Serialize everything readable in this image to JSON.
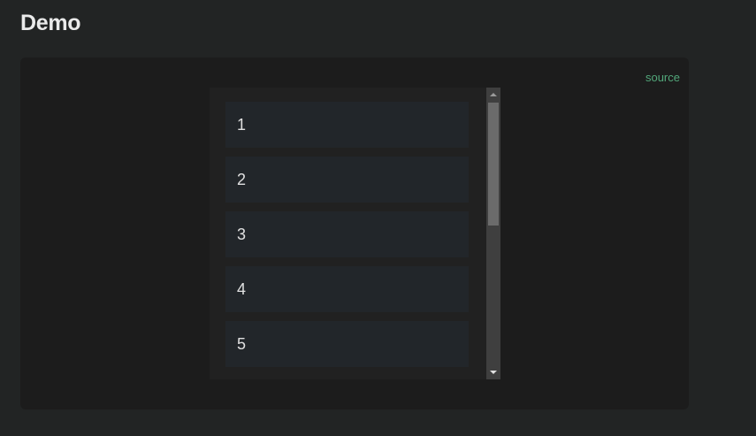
{
  "page": {
    "title": "Demo"
  },
  "demo": {
    "source_link": "source",
    "items": [
      "1",
      "2",
      "3",
      "4",
      "5"
    ]
  },
  "scrollbar": {
    "position_fraction": 0.0,
    "visible_fraction": 0.44
  },
  "colors": {
    "background": "#222424",
    "panel": "#1c1c1c",
    "item": "#22262a",
    "link": "#52a77a"
  }
}
